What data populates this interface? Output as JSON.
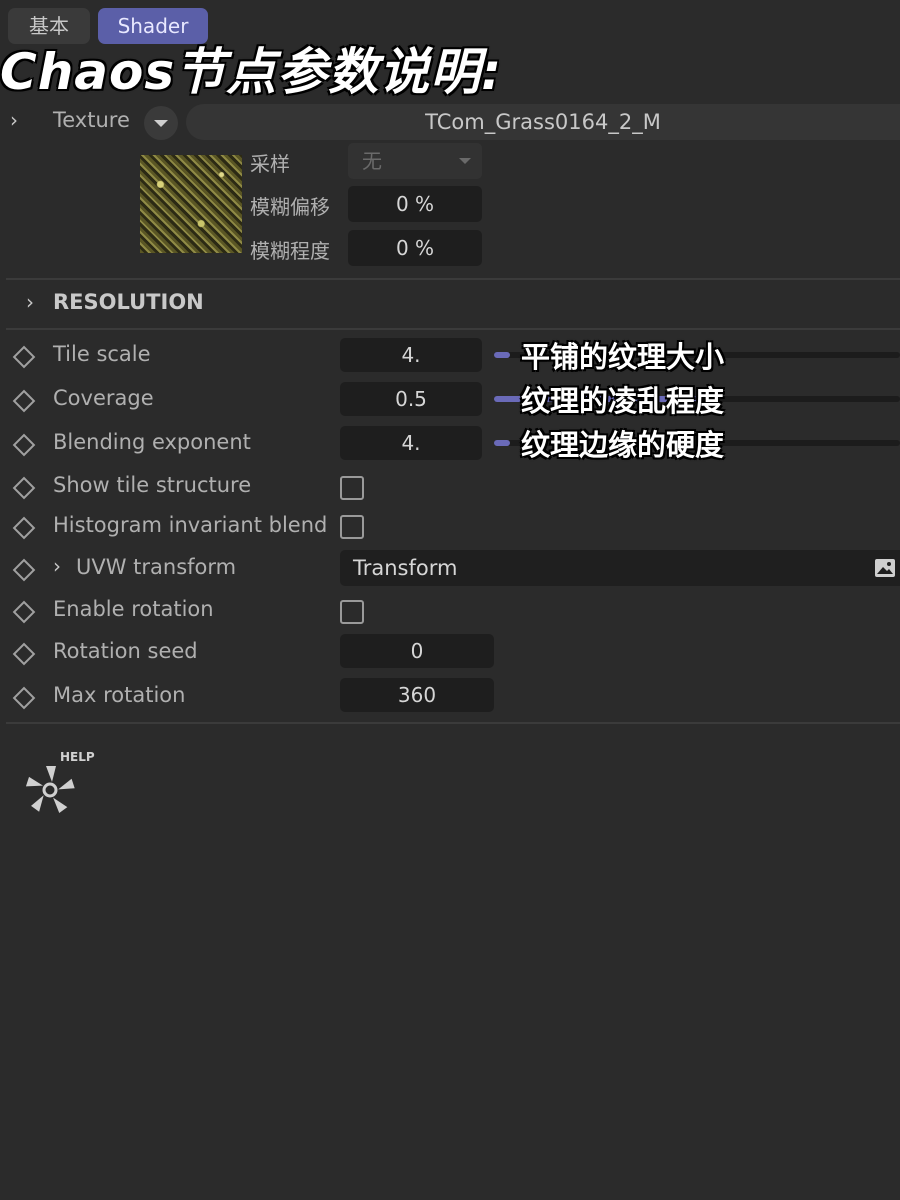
{
  "tabs": [
    {
      "label": "基本"
    },
    {
      "label": "Shader"
    }
  ],
  "overlay_title": "Chaos节点参数说明:",
  "texture": {
    "label": "Texture",
    "name": "TCom_Grass0164_2_M",
    "sampling_label": "采样",
    "sampling_value": "无",
    "blur_offset_label": "模糊偏移",
    "blur_offset_value": "0 %",
    "blur_amount_label": "模糊程度",
    "blur_amount_value": "0 %"
  },
  "resolution": {
    "label": "RESOLUTION"
  },
  "params": {
    "tile_scale": {
      "label": "Tile scale",
      "value": "4.",
      "slider_fraction": 0.04
    },
    "coverage": {
      "label": "Coverage",
      "value": "0.5",
      "slider_fraction": 0.5
    },
    "blending_exponent": {
      "label": "Blending exponent",
      "value": "4.",
      "slider_fraction": 0.04
    },
    "show_tile_structure": {
      "label": "Show tile structure",
      "checked": false
    },
    "histogram_invariant_blend": {
      "label": "Histogram invariant blend",
      "checked": false
    },
    "uvw_transform": {
      "label": "UVW transform",
      "value": "Transform"
    },
    "enable_rotation": {
      "label": "Enable rotation",
      "checked": false
    },
    "rotation_seed": {
      "label": "Rotation seed",
      "value": "0"
    },
    "max_rotation": {
      "label": "Max rotation",
      "value": "360"
    }
  },
  "annotations": {
    "tile_scale": "平铺的纹理大小",
    "coverage": "纹理的凌乱程度",
    "blending_exponent": "纹理边缘的硬度"
  },
  "help_label": "HELP",
  "colors": {
    "accent": "#5b5fa8",
    "slider_fill": "#6a6ab8",
    "background": "#2b2b2b"
  }
}
